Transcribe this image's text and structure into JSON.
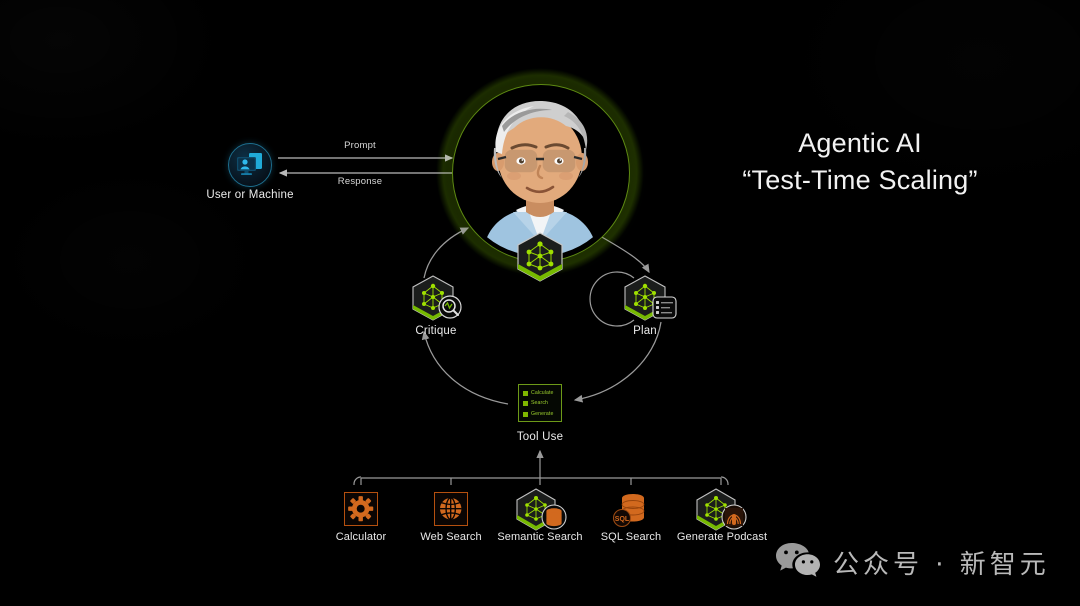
{
  "title": {
    "line1": "Agentic AI",
    "line2": "“Test-Time Scaling”"
  },
  "user": {
    "label": "User or Machine",
    "icon": "user-monitor-icon",
    "accent_color": "#2a9fd6"
  },
  "edges": {
    "prompt": "Prompt",
    "response": "Response"
  },
  "agent": {
    "icon": "nvidia-avatar-icon",
    "ring_color": "#76b900",
    "cube_icon": "neural-network-cube-icon"
  },
  "cycle": {
    "nodes": [
      {
        "label": "Critique",
        "icon": "cube-magnifier-icon"
      },
      {
        "label": "Plan",
        "icon": "cube-checklist-icon"
      },
      {
        "label": "Tool Use",
        "icon": "tool-use-list-icon"
      }
    ]
  },
  "tool_use": {
    "label": "Tool Use",
    "items": [
      "Calculate",
      "Search",
      "Generate"
    ],
    "accent_color": "#7fb800"
  },
  "tools": [
    {
      "label": "Calculator",
      "icon": "gear-icon",
      "color": "#d2691e"
    },
    {
      "label": "Web Search",
      "icon": "globe-icon",
      "color": "#d2691e"
    },
    {
      "label": "Semantic Search",
      "icon": "cube-database-icon",
      "color": "#76b900"
    },
    {
      "label": "SQL Search",
      "icon": "database-sql-icon",
      "color": "#d2691e"
    },
    {
      "label": "Generate Podcast",
      "icon": "cube-microphone-icon",
      "color": "#76b900"
    }
  ],
  "watermark": {
    "icon": "wechat-icon",
    "text": "公众号 · 新智元"
  },
  "theme": {
    "background": "#000000",
    "nvidia_green": "#76b900",
    "orange": "#d2691e",
    "cyan": "#2a9fd6",
    "text": "#eaeaea"
  }
}
